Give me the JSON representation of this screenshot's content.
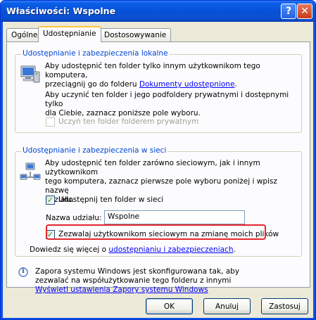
{
  "window": {
    "title": "Właściwości: Wspolne",
    "help_glyph": "?",
    "close_glyph": "✕"
  },
  "tabs": [
    "Ogólne",
    "Udostępnianie",
    "Dostosowywanie"
  ],
  "local_group": {
    "label": "Udostępnianie i zabezpieczenia lokalne",
    "text1_line1": "Aby udostępnić ten folder tylko innym użytkownikom tego komputera,",
    "text1_line2_prefix": "przeciągnij go do folderu ",
    "text1_link": "Dokumenty udostępnione",
    "text1_suffix": ".",
    "text2_line1": "Aby uczynić ten folder i jego podfoldery prywatnymi i dostępnymi tylko",
    "text2_line2": "dla Ciebie, zaznacz poniższe pole wyboru.",
    "private_checkbox_label": "Uczyń ten folder folderem prywatnym"
  },
  "network_group": {
    "label": "Udostępnianie i zabezpieczenia w sieci",
    "text_line1": "Aby udostępnić ten folder zarówno sieciowym, jak i innym użytkownikom",
    "text_line2": "tego komputera, zaznacz pierwsze pole wyboru poniżej i wpisz nazwę",
    "text_line3": "udziału.",
    "share_checkbox_label": "Udostępnij ten folder w sieci",
    "share_name_label": "Nazwa udziału:",
    "share_name_value": "Wspolne",
    "allow_change_label": "Zezwalaj użytkownikom sieciowym na zmianę moich plików",
    "learn_prefix": "Dowiedz się więcej o ",
    "learn_link": "udostępnianiu i zabezpieczeniach",
    "learn_suffix": "."
  },
  "firewall": {
    "info_glyph": "i",
    "line1": "Zapora systemu Windows jest skonfigurowana tak, aby",
    "line2": "zezwalać na współużytkowanie tego folderu z innymi",
    "link": "Wyświetl ustawienia Zapory systemu Windows"
  },
  "buttons": {
    "ok": "OK",
    "cancel": "Anuluj",
    "apply": "Zastosuj"
  },
  "colors": {
    "title_bar": "#0a54e3",
    "group_label": "#0046d5",
    "highlight": "#e3262b",
    "link": "#0000ff"
  }
}
